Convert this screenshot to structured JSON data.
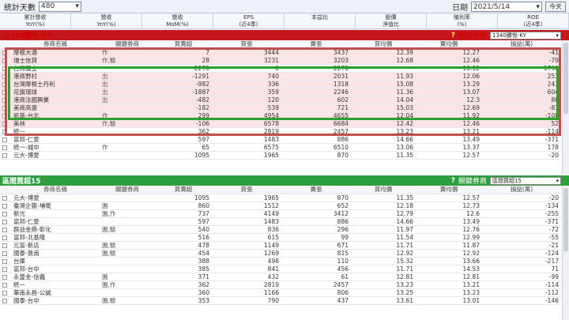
{
  "topbar": {
    "days_label": "統計天數",
    "days_value": "480",
    "date_label": "日期",
    "date_value": "2021/5/14",
    "today_label": "今天"
  },
  "metrics": [
    {
      "l1": "累計營收",
      "l2": "YoY(%)"
    },
    {
      "l1": "營收",
      "l2": "YoY(%)"
    },
    {
      "l1": "營收",
      "l2": "MoM(%)"
    },
    {
      "l1": "EPS",
      "l2": "(近4季)"
    },
    {
      "l1": "本益比",
      "l2": ""
    },
    {
      "l1": "股價",
      "l2": "淨值比"
    },
    {
      "l1": "殖利率",
      "l2": "(%)"
    },
    {
      "l1": "ROE",
      "l2": "(近4季)"
    }
  ],
  "panel1": {
    "title": ".1340勝悅-KY",
    "sel_label": "關鍵券商",
    "sel_value": "1340勝悅-KY",
    "headers": [
      "券商名稱",
      "關鍵券商",
      "買賣超",
      "買張",
      "賣張",
      "買均價",
      "賣均價",
      "損益(萬)"
    ],
    "rows": [
      {
        "name": "摩根大通",
        "tag": "作",
        "tagc": "",
        "v": "7",
        "b": "3444",
        "s": "3437",
        "bp": "12.39",
        "sp": "12.27",
        "pl": "-41",
        "pink": true
      },
      {
        "name": "瑞士信貸",
        "tag": "作,驗",
        "tagc": "grn",
        "v": "28",
        "b": "3231",
        "s": "3203",
        "bp": "12.68",
        "sp": "12.46",
        "pl": "-79",
        "pink": true
      },
      {
        "name": "台灣匯立",
        "tag": "",
        "tagc": "",
        "v": "-2270",
        "b": "0",
        "s": "2270",
        "bp": "--",
        "sp": "18.12",
        "pl": "1798",
        "pink": false
      },
      {
        "name": "港商野村",
        "tag": "出",
        "tagc": "grn",
        "v": "-1291",
        "b": "740",
        "s": "2031",
        "bp": "11.93",
        "sp": "12.06",
        "pl": "251",
        "pink": true
      },
      {
        "name": "台灣摩根士丹利",
        "tag": "出",
        "tagc": "grn",
        "v": "-982",
        "b": "336",
        "s": "1318",
        "bp": "15.08",
        "sp": "13.29",
        "pl": "243",
        "pink": true
      },
      {
        "name": "花旗環球",
        "tag": "出",
        "tagc": "grn",
        "v": "-1887",
        "b": "359",
        "s": "2246",
        "bp": "11.36",
        "sp": "13.07",
        "pl": "604",
        "pink": true
      },
      {
        "name": "港商法國興業",
        "tag": "出",
        "tagc": "grn",
        "v": "-482",
        "b": "120",
        "s": "602",
        "bp": "14.04",
        "sp": "12.3",
        "pl": "80",
        "pink": true
      },
      {
        "name": "美商高盛",
        "tag": "",
        "tagc": "",
        "v": "-182",
        "b": "539",
        "s": "721",
        "bp": "15.03",
        "sp": "12.69",
        "pl": "-81",
        "pink": true
      },
      {
        "name": "凱基-台北",
        "tag": "作",
        "tagc": "",
        "v": "299",
        "b": "4954",
        "s": "4655",
        "bp": "12.04",
        "sp": "11.92",
        "pl": "-108",
        "pink": true
      },
      {
        "name": "美林",
        "tag": "作,驗",
        "tagc": "red",
        "v": "-106",
        "b": "6578",
        "s": "6684",
        "bp": "12.42",
        "sp": "12.46",
        "pl": "52",
        "pink": true
      },
      {
        "name": "統一",
        "tag": "",
        "tagc": "",
        "v": "362",
        "b": "2819",
        "s": "2457",
        "bp": "13.23",
        "sp": "13.21",
        "pl": "-114",
        "pink": false
      },
      {
        "name": "富邦-仁愛",
        "tag": "",
        "tagc": "",
        "v": "597",
        "b": "1483",
        "s": "886",
        "bp": "14.66",
        "sp": "13.49",
        "pl": "-371",
        "pink": false
      },
      {
        "name": "統一-城中",
        "tag": "作",
        "tagc": "",
        "v": "65",
        "b": "6575",
        "s": "6510",
        "bp": "13.06",
        "sp": "13.37",
        "pl": "178",
        "pink": false
      },
      {
        "name": "元大-博愛",
        "tag": "",
        "tagc": "",
        "v": "1095",
        "b": "1965",
        "s": "870",
        "bp": "11.35",
        "sp": "12.57",
        "pl": "-20",
        "pink": false
      }
    ]
  },
  "panel2": {
    "title": "區間買超15",
    "sel_label": "關鍵券商",
    "sel_value": "區間買超15",
    "headers": [
      "券商名稱",
      "關鍵券商",
      "買賣超",
      "買張",
      "賣張",
      "買均價",
      "賣均價",
      "損益(萬)"
    ],
    "rows": [
      {
        "name": "元大-博愛",
        "tag": "",
        "tagc": "",
        "v": "1095",
        "b": "1965",
        "s": "870",
        "bp": "11.35",
        "sp": "12.57",
        "pl": "-20",
        "pink": false
      },
      {
        "name": "臺灣企銀-埔墘",
        "tag": "園",
        "tagc": "red",
        "v": "860",
        "b": "1512",
        "s": "652",
        "bp": "12.18",
        "sp": "12.73",
        "pl": "-134",
        "pink": false
      },
      {
        "name": "新光",
        "tag": "園,作",
        "tagc": "red",
        "v": "737",
        "b": "4149",
        "s": "3412",
        "bp": "12.79",
        "sp": "12.6",
        "pl": "-255",
        "pink": false
      },
      {
        "name": "富邦-仁愛",
        "tag": "",
        "tagc": "",
        "v": "597",
        "b": "1483",
        "s": "886",
        "bp": "14.66",
        "sp": "13.49",
        "pl": "-371",
        "pink": false
      },
      {
        "name": "群益金鼎-彰化",
        "tag": "園,驗",
        "tagc": "red",
        "v": "540",
        "b": "836",
        "s": "296",
        "bp": "11.97",
        "sp": "12.76",
        "pl": "-72",
        "pink": false
      },
      {
        "name": "富邦-北基隆",
        "tag": "",
        "tagc": "",
        "v": "516",
        "b": "615",
        "s": "99",
        "bp": "11.54",
        "sp": "12.99",
        "pl": "-55",
        "pink": false
      },
      {
        "name": "元富-新店",
        "tag": "園,驗",
        "tagc": "red",
        "v": "478",
        "b": "1149",
        "s": "671",
        "bp": "11.71",
        "sp": "11.87",
        "pl": "-21",
        "pink": false
      },
      {
        "name": "國泰-敦南",
        "tag": "園,驗",
        "tagc": "red",
        "v": "454",
        "b": "1269",
        "s": "815",
        "bp": "12.92",
        "sp": "12.92",
        "pl": "-124",
        "pink": false
      },
      {
        "name": "台庫",
        "tag": "",
        "tagc": "",
        "v": "388",
        "b": "498",
        "s": "110",
        "bp": "15.32",
        "sp": "13.66",
        "pl": "-217",
        "pink": false
      },
      {
        "name": "富邦-台中",
        "tag": "",
        "tagc": "",
        "v": "385",
        "b": "841",
        "s": "456",
        "bp": "11.71",
        "sp": "14.53",
        "pl": "71",
        "pink": false
      },
      {
        "name": "永豐金-信義",
        "tag": "園",
        "tagc": "red",
        "v": "371",
        "b": "432",
        "s": "61",
        "bp": "12.81",
        "sp": "12.81",
        "pl": "-99",
        "pink": false
      },
      {
        "name": "統一",
        "tag": "園,作",
        "tagc": "red",
        "v": "362",
        "b": "2819",
        "s": "2457",
        "bp": "13.23",
        "sp": "13.21",
        "pl": "-114",
        "pink": false
      },
      {
        "name": "華南永昌-公誠",
        "tag": "",
        "tagc": "",
        "v": "360",
        "b": "1166",
        "s": "806",
        "bp": "13.25",
        "sp": "13.23",
        "pl": "-112",
        "pink": false
      },
      {
        "name": "國泰-台中",
        "tag": "園,驗",
        "tagc": "red",
        "v": "353",
        "b": "790",
        "s": "437",
        "bp": "13.61",
        "sp": "13.01",
        "pl": "-146",
        "pink": false
      }
    ]
  }
}
